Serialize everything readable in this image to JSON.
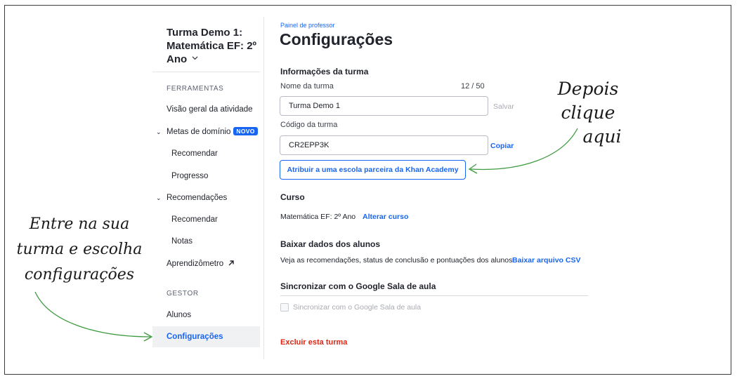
{
  "sidebar": {
    "class_title": "Turma Demo 1: Matemática EF: 2º Ano",
    "tools_heading": "FERRAMENTAS",
    "items": {
      "activity_overview": "Visão geral da atividade",
      "mastery_goals": "Metas de domínio",
      "new_badge": "NOVO",
      "mastery_recommend": "Recomendar",
      "mastery_progress": "Progresso",
      "recommendations": "Recomendações",
      "rec_recommend": "Recomendar",
      "rec_grades": "Notas",
      "learning_meter": "Aprendizômetro"
    },
    "manager_heading": "GESTOR",
    "manager_items": {
      "students": "Alunos",
      "settings": "Configurações"
    }
  },
  "main": {
    "breadcrumb": "Painel de professor",
    "title": "Configurações",
    "class_info": {
      "heading": "Informações da turma",
      "name_label": "Nome da turma",
      "name_counter": "12 / 50",
      "name_value": "Turma Demo 1",
      "save_label": "Salvar",
      "code_label": "Código da turma",
      "code_value": "CR2EPP3K",
      "copy_label": "Copiar",
      "partner_button": "Atribuir a uma escola parceira da Khan Academy"
    },
    "course": {
      "heading": "Curso",
      "value": "Matemática EF: 2º Ano",
      "change_label": "Alterar curso"
    },
    "download": {
      "heading": "Baixar dados dos alunos",
      "description": "Veja as recomendações, status de conclusão e pontuações dos alunos",
      "csv_label": "Baixar arquivo CSV"
    },
    "google": {
      "heading": "Sincronizar com o Google Sala de aula",
      "checkbox_label": "Sincronizar com o Google Sala de aula"
    },
    "delete_label": "Excluir esta turma"
  },
  "annotations": {
    "right": [
      "Depois clique",
      "aqui"
    ],
    "left": [
      "Entre na sua",
      "turma e escolha",
      "configurações"
    ]
  },
  "colors": {
    "accent": "#1865f2",
    "danger": "#d92916",
    "annotation_arrow": "#3d9a3f"
  }
}
